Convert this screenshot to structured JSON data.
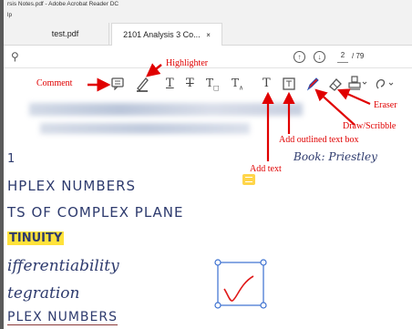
{
  "window": {
    "title": "rsis Notes.pdf - Adobe Acrobat Reader DC",
    "menu": "lp"
  },
  "tabs": [
    {
      "label": "test.pdf",
      "active": false
    },
    {
      "label": "2101 Analysis 3 Co...",
      "active": true,
      "close": "×"
    }
  ],
  "toolbar": {
    "page_current": "2",
    "page_total": "/ 79"
  },
  "annotations": {
    "highlighter": "Highlighter",
    "comment": "Comment",
    "eraser": "Eraser",
    "draw_scribble": "Draw/Scribble",
    "add_outlined_text_box": "Add outlined text box",
    "add_text": "Add text"
  },
  "document": {
    "lines": [
      "1",
      "HPLEX NUMBERS",
      "TS OF COMPLEX PLANE",
      "TINUITY",
      "ifferentiability",
      "tegration",
      "PLEX NUMBERS"
    ],
    "book": "Book: Priestley"
  },
  "colors": {
    "annotation_red": "#e00000",
    "highlight_yellow": "#ffe23a",
    "draw_pen": "#e01a1a",
    "ink": "#2e3b6e"
  }
}
